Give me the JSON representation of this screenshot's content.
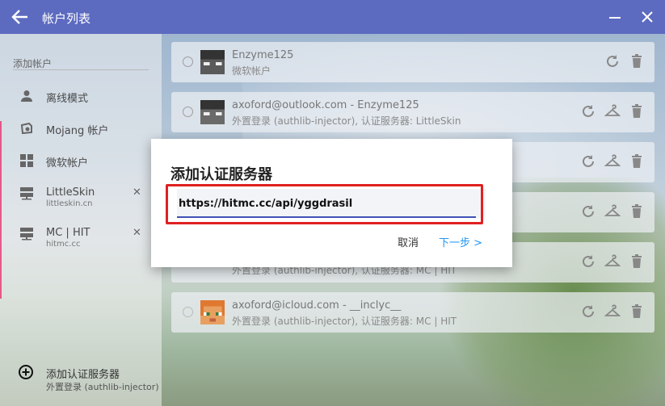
{
  "window": {
    "title": "帐户列表"
  },
  "sidebar": {
    "section_header": "添加帐户",
    "items": [
      {
        "label": "离线模式",
        "sub": "",
        "icon": "person-icon"
      },
      {
        "label": "Mojang 帐户",
        "sub": "",
        "icon": "mojang-icon"
      },
      {
        "label": "微软帐户",
        "sub": "",
        "icon": "windows-icon"
      },
      {
        "label": "LittleSkin",
        "sub": "littleskin.cn",
        "icon": "server-icon",
        "removable": true
      },
      {
        "label": "MC | HIT",
        "sub": "hitmc.cc",
        "icon": "server-icon",
        "removable": true
      }
    ],
    "add_server": {
      "label": "添加认证服务器",
      "sub": "外置登录 (authlib-injector)",
      "icon": "plus-circle-icon"
    },
    "remove_glyph": "✕"
  },
  "accounts": [
    {
      "name": "Enzyme125",
      "type": "微软帐户",
      "actions": [
        "refresh-icon",
        "delete-icon"
      ]
    },
    {
      "name": "axoford@outlook.com - Enzyme125",
      "type": "外置登录 (authlib-injector), 认证服务器: LittleSkin",
      "actions": [
        "refresh-icon",
        "skin-icon",
        "delete-icon"
      ]
    },
    {
      "name": "",
      "type": "",
      "actions": [
        "refresh-icon",
        "skin-icon",
        "delete-icon"
      ]
    },
    {
      "name": "",
      "type": "",
      "actions": [
        "refresh-icon",
        "skin-icon",
        "delete-icon"
      ]
    },
    {
      "name": "",
      "type": "外置登录 (authlib-injector), 认证服务器: MC | HIT",
      "actions": [
        "refresh-icon",
        "skin-icon",
        "delete-icon"
      ]
    },
    {
      "name": "axoford@icloud.com - __inclyc__",
      "type": "外置登录 (authlib-injector), 认证服务器: MC | HIT",
      "actions": [
        "refresh-icon",
        "skin-icon",
        "delete-icon"
      ]
    }
  ],
  "dialog": {
    "title": "添加认证服务器",
    "input_value": "https://hitmc.cc/api/yggdrasil",
    "cancel_label": "取消",
    "next_label": "下一步 >"
  },
  "colors": {
    "titlebar": "#5c6bc0",
    "accent": "#3f51b5",
    "link": "#2196f3",
    "highlight": "#e02020"
  }
}
